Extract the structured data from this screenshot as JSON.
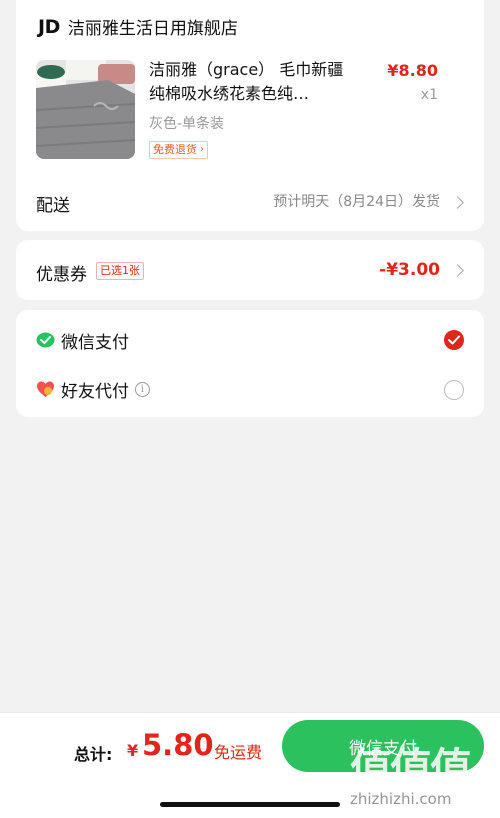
{
  "shop": {
    "logo": "JD",
    "name": "洁丽雅生活日用旗舰店"
  },
  "product": {
    "title": "洁丽雅（grace） 毛巾新疆纯棉吸水绣花素色纯…",
    "price": "¥8.80",
    "quantity": "x1",
    "variant": "灰色-单条装",
    "return_tag": "免费退货"
  },
  "delivery": {
    "label": "配送",
    "value": "预计明天（8月24日）发货"
  },
  "coupon": {
    "label": "优惠券",
    "tag": "已选1张",
    "amount": "-¥3.00"
  },
  "payment": {
    "wechat_label": "微信支付",
    "friend_label": "好友代付",
    "wechat_color": "#2ac15e",
    "selected_color": "#e1251b"
  },
  "bottom": {
    "total_label": "总计:",
    "currency": "¥",
    "total_amount": "5.80",
    "free_shipping": "免运费",
    "pay_button": "微信支付"
  },
  "watermark": {
    "logo": "值值值",
    "url": "zhizhizhi.com"
  }
}
